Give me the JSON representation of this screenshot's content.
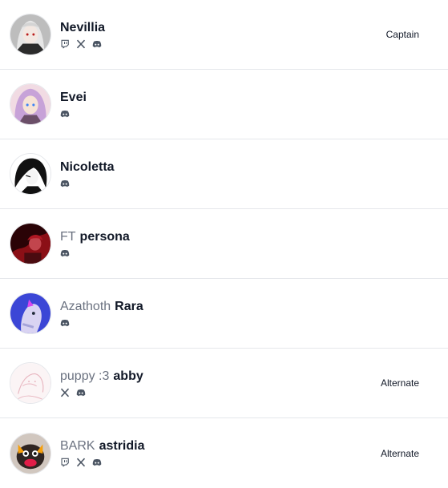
{
  "members": [
    {
      "team_tag": "",
      "name": "Nevillia",
      "role": "Captain",
      "socials": [
        "twitch-icon",
        "x-icon",
        "discord-icon"
      ],
      "avatar_color": "#c9c9c9"
    },
    {
      "team_tag": "",
      "name": "Evei",
      "role": "",
      "socials": [
        "discord-icon"
      ],
      "avatar_color": "#e9c3d2"
    },
    {
      "team_tag": "",
      "name": "Nicoletta",
      "role": "",
      "socials": [
        "discord-icon"
      ],
      "avatar_color": "#f2f2f2"
    },
    {
      "team_tag": "FT",
      "name": "persona",
      "role": "",
      "socials": [
        "discord-icon"
      ],
      "avatar_color": "#8b0f16"
    },
    {
      "team_tag": "Azathoth",
      "name": "Rara",
      "role": "",
      "socials": [
        "discord-icon"
      ],
      "avatar_color": "#3b46d6"
    },
    {
      "team_tag": "puppy :3",
      "name": "abby",
      "role": "Alternate",
      "socials": [
        "x-icon",
        "discord-icon"
      ],
      "avatar_color": "#f6e4e8"
    },
    {
      "team_tag": "BARK",
      "name": "astridia",
      "role": "Alternate",
      "socials": [
        "twitch-icon",
        "x-icon",
        "discord-icon"
      ],
      "avatar_color": "#3b2f2a"
    }
  ],
  "icon_color": "#4b5563"
}
